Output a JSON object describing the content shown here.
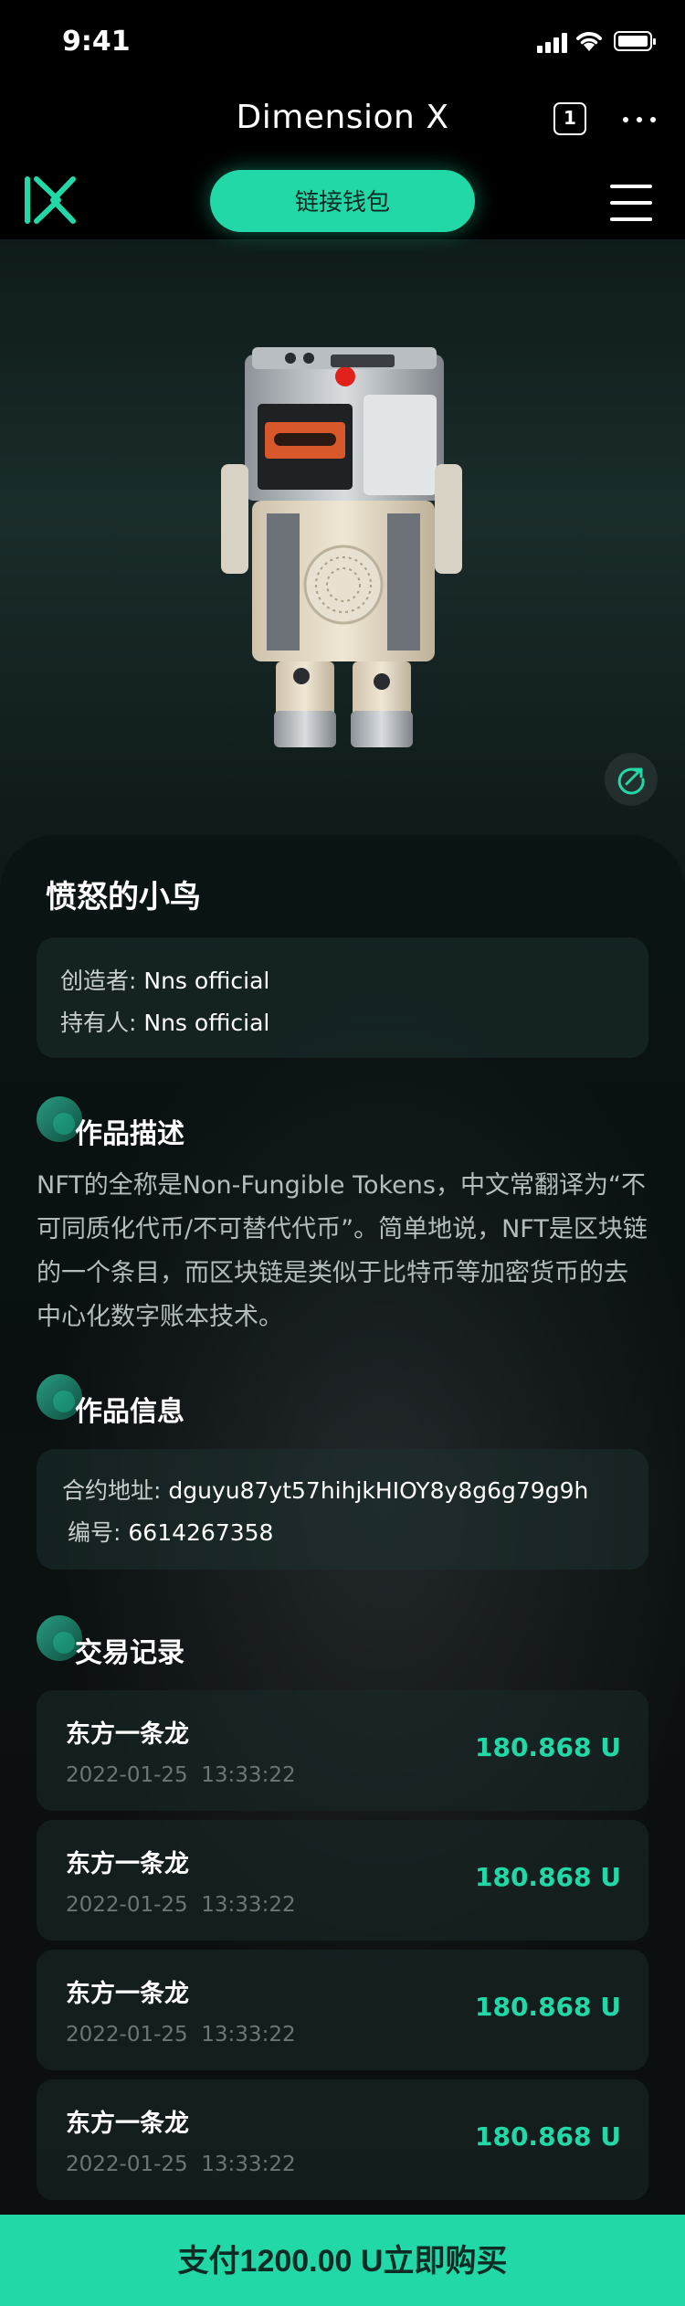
{
  "status_bar": {
    "time": "9:41"
  },
  "header": {
    "title": "Dimension X",
    "tab_count": "1"
  },
  "nav": {
    "connect_wallet": "链接钱包"
  },
  "colors": {
    "accent": "#22d8a6",
    "background": "#000000",
    "card": "#1e3030"
  },
  "icons": [
    "dimension-x-logo",
    "menu-icon",
    "share-icon",
    "tab-count-icon",
    "more-icon"
  ],
  "nft": {
    "name": "愤怒的小鸟",
    "creator_label": "创造者:",
    "creator": "Nns official",
    "owner_label": "持有人:",
    "owner": "Nns official"
  },
  "description": {
    "heading": "作品描述",
    "text": "NFT的全称是Non-Fungible Tokens，中文常翻译为“不可同质化代币/不可替代代币”。简单地说，NFT是区块链的一个条目，而区块链是类似于比特币等加密货币的去中心化数字账本技术。"
  },
  "info": {
    "heading": "作品信息",
    "contract_label": "合约地址:",
    "contract": "dguyu87yt57hihjkHIOY8y8g6g79g9h",
    "number_label": "编号:",
    "number": "6614267358"
  },
  "transactions": {
    "heading": "交易记录",
    "items": [
      {
        "name": "东方一条龙",
        "time": "2022-01-25  13:33:22",
        "amount": "180.868 U"
      },
      {
        "name": "东方一条龙",
        "time": "2022-01-25  13:33:22",
        "amount": "180.868 U"
      },
      {
        "name": "东方一条龙",
        "time": "2022-01-25  13:33:22",
        "amount": "180.868 U"
      },
      {
        "name": "东方一条龙",
        "time": "2022-01-25  13:33:22",
        "amount": "180.868 U"
      }
    ]
  },
  "buy": {
    "label": "支付1200.00 U立即购买"
  }
}
